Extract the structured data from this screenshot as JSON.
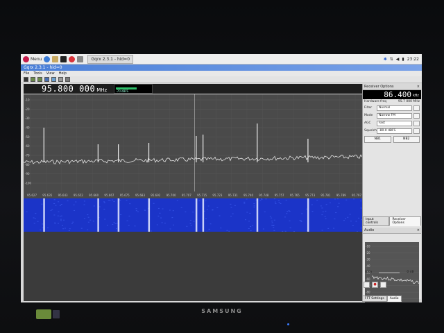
{
  "taskbar": {
    "menu_label": "Menu",
    "task_label": "Gqrx 2.3.1 - hid=0",
    "clock": "23:22"
  },
  "window": {
    "title": "Gqrx 2.3.1 - hid=0"
  },
  "menu": [
    "File",
    "Tools",
    "View",
    "Help"
  ],
  "main": {
    "frequency": "95.800 000",
    "frequency_unit": "MHz",
    "meter_label": "-70 dBFS",
    "meter_level": 0.6
  },
  "spectrum": {
    "y_ticks": [
      "-10",
      "-20",
      "-30",
      "-40",
      "-50",
      "-60",
      "-70",
      "-80",
      "-90",
      "-100"
    ],
    "x_ticks": [
      "95.627",
      "95.635",
      "95.643",
      "95.652",
      "95.660",
      "95.667",
      "95.675",
      "95.683",
      "95.692",
      "95.700",
      "95.707",
      "95.715",
      "95.723",
      "95.731",
      "95.740",
      "95.748",
      "95.757",
      "95.765",
      "95.773",
      "95.781",
      "95.789",
      "95.797"
    ],
    "peaks": [
      0.06,
      0.22,
      0.28,
      0.37,
      0.51,
      0.53,
      0.69,
      0.84
    ]
  },
  "receiver": {
    "title": "Receiver Options",
    "frequency": "86.400",
    "frequency_unit": "kHz",
    "hw_label": "Hardware freq",
    "hw_value": "95.7 000 MHz",
    "options": [
      {
        "label": "Filter",
        "value": "Normal"
      },
      {
        "label": "Mode",
        "value": "Narrow FM"
      },
      {
        "label": "AGC",
        "value": "Fast"
      },
      {
        "label": "Squelch",
        "value": "-80.0 dBFS"
      }
    ],
    "nb1": "NB1",
    "nb2": "NB2",
    "tabs": [
      "Input controls",
      "Receiver Options"
    ]
  },
  "audio": {
    "title": "Audio",
    "y_ticks": [
      "-10",
      "-20",
      "-30",
      "-40",
      "-50",
      "-60",
      "-70",
      "-80",
      "-90",
      "-100",
      "-110",
      "-120"
    ],
    "gain_label": "Gain",
    "gain_value": "0 dB",
    "tabs": [
      "FFT Settings",
      "Audio"
    ]
  },
  "monitor": {
    "brand": "SAMSUNG"
  }
}
